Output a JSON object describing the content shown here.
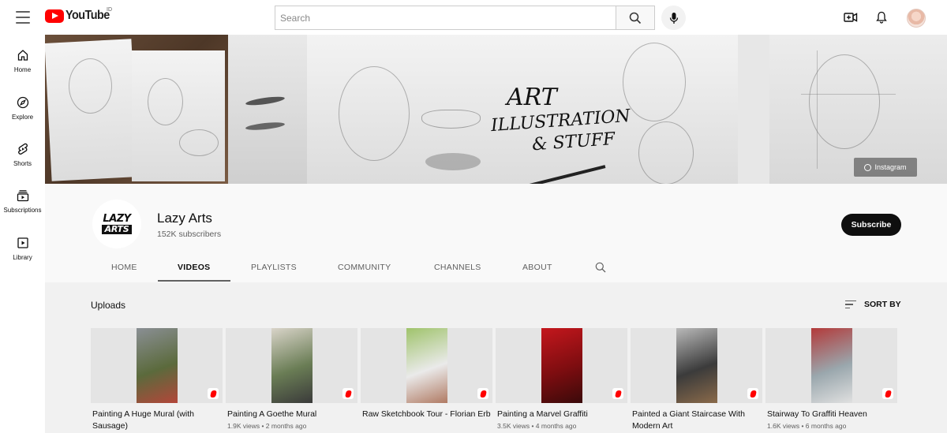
{
  "app": {
    "logo_text": "YouTube",
    "country_code": "ID",
    "search_placeholder": "Search"
  },
  "sidebar": {
    "items": [
      {
        "label": "Home",
        "icon": "home-icon"
      },
      {
        "label": "Explore",
        "icon": "compass-icon"
      },
      {
        "label": "Shorts",
        "icon": "shorts-icon"
      },
      {
        "label": "Subscriptions",
        "icon": "subscriptions-icon"
      },
      {
        "label": "Library",
        "icon": "library-icon"
      }
    ]
  },
  "banner": {
    "title_line1": "ART",
    "title_line2": "ILLUSTRATION",
    "title_line3": "& STUFF",
    "link_label": "Instagram"
  },
  "channel": {
    "avatar_top": "LAZY",
    "avatar_bottom": "ARTS",
    "name": "Lazy Arts",
    "subscribers": "152K subscribers",
    "subscribe_label": "Subscribe",
    "tabs": [
      "HOME",
      "VIDEOS",
      "PLAYLISTS",
      "COMMUNITY",
      "CHANNELS",
      "ABOUT"
    ],
    "active_tab": "VIDEOS"
  },
  "content": {
    "section_title": "Uploads",
    "sort_label": "SORT BY",
    "videos": [
      {
        "title": "Painting A Huge Mural (with Sausage)",
        "meta": "",
        "thumb_colors": [
          "#8a8f94",
          "#5b6a3c",
          "#b3463a"
        ]
      },
      {
        "title": "Painting A Goethe Mural",
        "meta": "1.9K views • 2 months ago",
        "thumb_colors": [
          "#d9d4c9",
          "#6a7d55",
          "#3a3a3a"
        ]
      },
      {
        "title": "Raw Sketchbook Tour - Florian Erb",
        "meta": "",
        "thumb_colors": [
          "#9fc36b",
          "#eaeaea",
          "#b07a63"
        ]
      },
      {
        "title": "Painting a Marvel Graffiti",
        "meta": "3.5K views • 4 months ago",
        "thumb_colors": [
          "#c4171d",
          "#7e0d10",
          "#3a0a0a"
        ]
      },
      {
        "title": "Painted a Giant Staircase With Modern Art",
        "meta": "",
        "thumb_colors": [
          "#b9b9b9",
          "#3b3b3b",
          "#8a6a4a"
        ]
      },
      {
        "title": "Stairway To Graffiti Heaven",
        "meta": "1.6K views • 6 months ago",
        "thumb_colors": [
          "#b33a3a",
          "#9aa7ad",
          "#e0e0e0"
        ]
      }
    ]
  }
}
